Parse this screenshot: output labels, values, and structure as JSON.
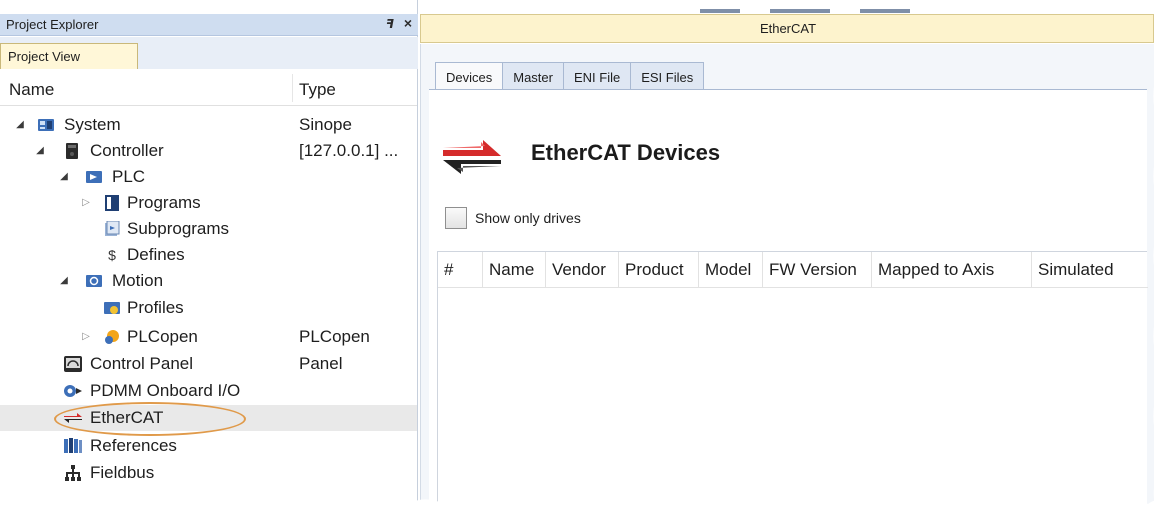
{
  "project_explorer": {
    "title": "Project Explorer",
    "pin_glyph": "ꟻ",
    "close_glyph": "×",
    "tab_label": "Project View",
    "columns": {
      "name": "Name",
      "type": "Type"
    },
    "tree": [
      {
        "label": "System",
        "type": "Sinope",
        "icon": "system-icon",
        "expander": "expanded"
      },
      {
        "label": "Controller",
        "type": "[127.0.0.1] ...",
        "icon": "controller-icon",
        "expander": "expanded"
      },
      {
        "label": "PLC",
        "type": "",
        "icon": "plc-icon",
        "expander": "expanded"
      },
      {
        "label": "Programs",
        "type": "",
        "icon": "programs-icon",
        "expander": "collapsed"
      },
      {
        "label": "Subprograms",
        "type": "",
        "icon": "subprograms-icon",
        "expander": "none"
      },
      {
        "label": "Defines",
        "type": "",
        "icon": "defines-icon",
        "expander": "none"
      },
      {
        "label": "Motion",
        "type": "",
        "icon": "motion-icon",
        "expander": "expanded"
      },
      {
        "label": "Profiles",
        "type": "",
        "icon": "profiles-icon",
        "expander": "none"
      },
      {
        "label": "PLCopen",
        "type": "PLCopen",
        "icon": "plcopen-icon",
        "expander": "collapsed"
      },
      {
        "label": "Control Panel",
        "type": "Panel",
        "icon": "control-panel-icon",
        "expander": "none"
      },
      {
        "label": "PDMM Onboard I/O",
        "type": "",
        "icon": "onboard-io-icon",
        "expander": "none"
      },
      {
        "label": "EtherCAT",
        "type": "",
        "icon": "ethercat-icon",
        "expander": "none",
        "selected": true
      },
      {
        "label": "References",
        "type": "",
        "icon": "references-icon",
        "expander": "none"
      },
      {
        "label": "Fieldbus",
        "type": "",
        "icon": "fieldbus-icon",
        "expander": "none"
      }
    ]
  },
  "document": {
    "title": "EtherCAT",
    "tabs": [
      "Devices",
      "Master",
      "ENI File",
      "ESI Files"
    ],
    "active_tab": "Devices",
    "heading": "EtherCAT Devices",
    "show_only_drives_label": "Show only drives",
    "show_only_drives_checked": false,
    "table_columns": [
      "#",
      "Name",
      "Vendor",
      "Product",
      "Model",
      "FW Version",
      "Mapped to Axis",
      "Simulated"
    ],
    "table_rows": []
  },
  "colors": {
    "panel_header": "#cfddf0",
    "doc_header": "#fdf3cd",
    "highlight_ellipse": "#e09a4a",
    "logo_red": "#d52b2b",
    "logo_dark": "#222222"
  }
}
